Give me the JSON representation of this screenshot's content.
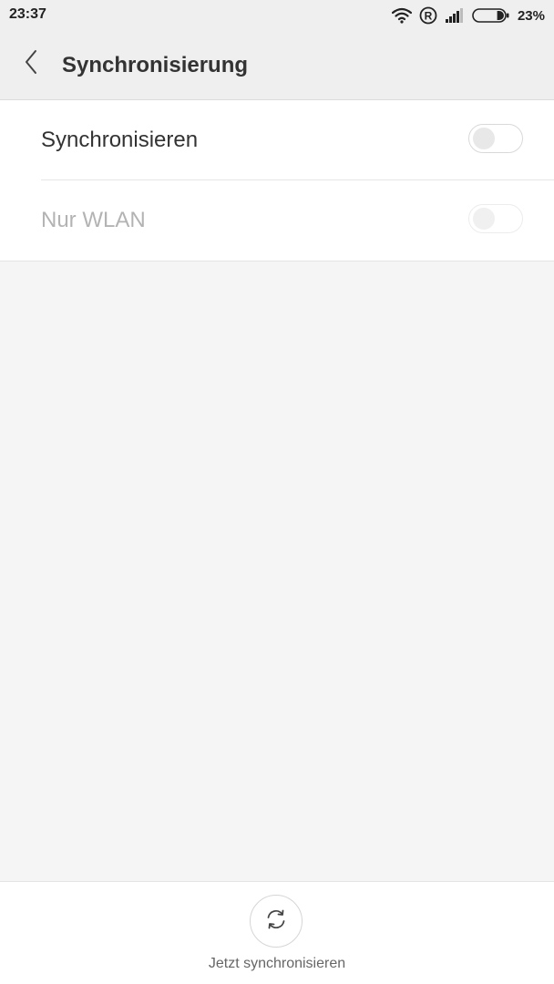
{
  "status_bar": {
    "time": "23:37",
    "battery_percent": "23%",
    "battery_level": 0.23,
    "icons": [
      "wifi-icon",
      "roaming-r-icon",
      "signal-icon",
      "battery-icon"
    ]
  },
  "header": {
    "title": "Synchronisierung",
    "back_icon": "chevron-left-icon"
  },
  "settings": {
    "items": [
      {
        "label": "Synchronisieren",
        "enabled": true,
        "checked": false
      },
      {
        "label": "Nur WLAN",
        "enabled": false,
        "checked": false
      }
    ]
  },
  "bottom_bar": {
    "sync_now_label": "Jetzt synchronisieren",
    "sync_icon": "sync-icon"
  },
  "colors": {
    "header_bg": "#efefef",
    "content_bg": "#f5f5f5",
    "text_primary": "#333333",
    "text_disabled": "#b3b3b3"
  }
}
